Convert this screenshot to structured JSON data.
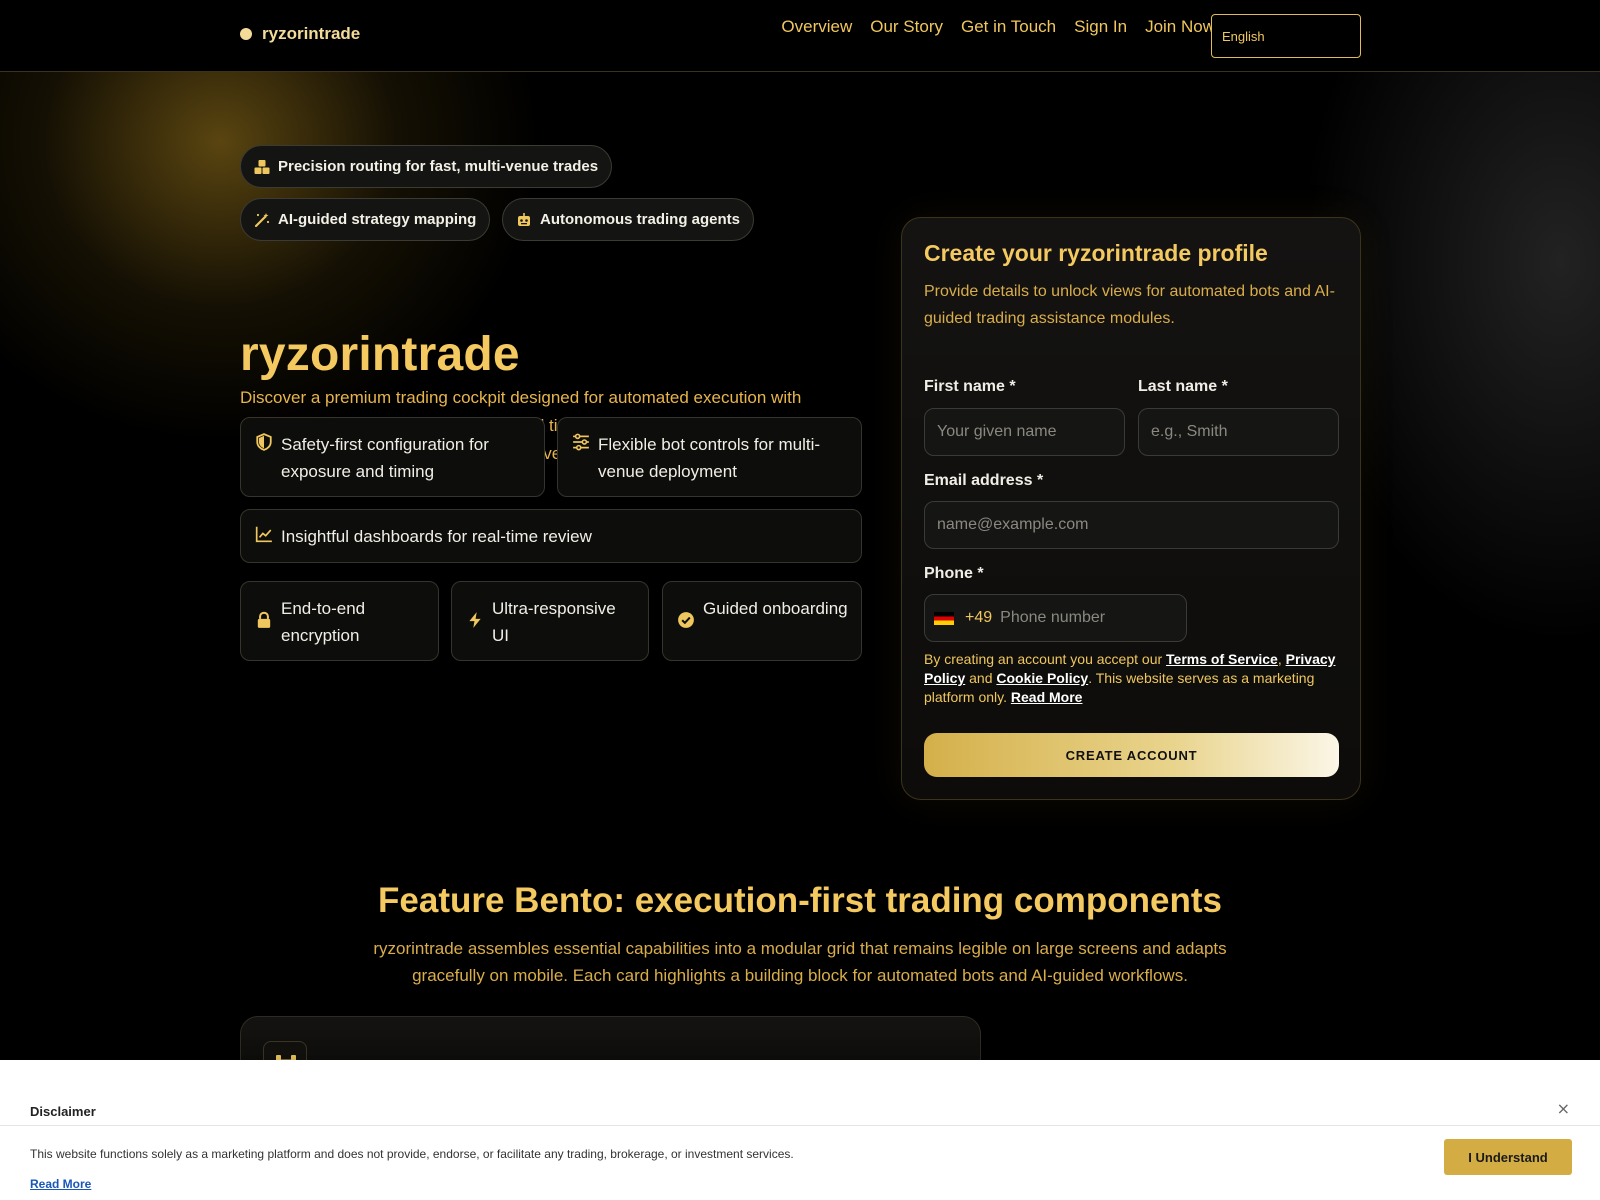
{
  "header": {
    "brand": "ryzorintrade",
    "nav": [
      {
        "label": "Overview"
      },
      {
        "label": "Our Story"
      },
      {
        "label": "Get in Touch"
      },
      {
        "label": "Sign In"
      },
      {
        "label": "Join Now"
      }
    ],
    "language": "English"
  },
  "hero": {
    "pills": [
      {
        "label": "Precision routing for fast, multi-venue trades",
        "icon": "cubes-icon"
      },
      {
        "label": "AI-guided strategy mapping",
        "icon": "magic-wand-icon"
      },
      {
        "label": "Autonomous trading agents",
        "icon": "robot-icon"
      }
    ],
    "title": "ryzorintrade",
    "description": "Discover a premium trading cockpit designed for automated execution with structured blocks, intelligent routing, and timing logic. AI-driven guidance structures inputs into clear modules, delivering consistency across sessions.",
    "features": [
      {
        "label": "Safety-first configuration for exposure and timing",
        "icon": "shield-icon"
      },
      {
        "label": "Flexible bot controls for multi-venue deployment",
        "icon": "sliders-icon"
      },
      {
        "label": "Insightful dashboards for real-time review",
        "icon": "chart-line-icon"
      }
    ],
    "badges": [
      {
        "label": "End-to-end encryption",
        "icon": "lock-icon"
      },
      {
        "label": "Ultra-responsive UI",
        "icon": "bolt-icon"
      },
      {
        "label": "Guided onboarding",
        "icon": "check-circle-icon"
      }
    ]
  },
  "form": {
    "title": "Create your ryzorintrade profile",
    "subtitle": "Provide details to unlock views for automated bots and AI-guided trading assistance modules.",
    "first_name_label": "First name *",
    "first_name_placeholder": "Your given name",
    "last_name_label": "Last name *",
    "last_name_placeholder": "e.g., Smith",
    "email_label": "Email address *",
    "email_placeholder": "name@example.com",
    "phone_label": "Phone *",
    "phone_code": "+49",
    "phone_placeholder": "Phone number",
    "legal_1": "By creating an account you accept our ",
    "terms": "Terms of Service",
    "legal_2": ", ",
    "privacy": "Privacy Policy",
    "legal_3": " and ",
    "cookie": "Cookie Policy",
    "legal_4": ". This website serves as a marketing platform only. ",
    "read_more": "Read More",
    "submit": "CREATE ACCOUNT"
  },
  "features_section": {
    "title": "Feature Bento: execution-first trading components",
    "description": "ryzorintrade assembles essential capabilities into a modular grid that remains legible on large screens and adapts gracefully on mobile. Each card highlights a building block for automated bots and AI-guided workflows.",
    "first_card_icon": "dumbbell-icon"
  },
  "disclaimer": {
    "title": "Disclaimer",
    "close": "×",
    "text": "This website functions solely as a marketing platform and does not provide, endorse, or facilitate any trading, brokerage, or investment services.",
    "read_more": "Read More",
    "button": "I Understand"
  },
  "colors": {
    "accent": "#f3c960",
    "background": "#000000",
    "button_gold": "#d3ad43"
  }
}
